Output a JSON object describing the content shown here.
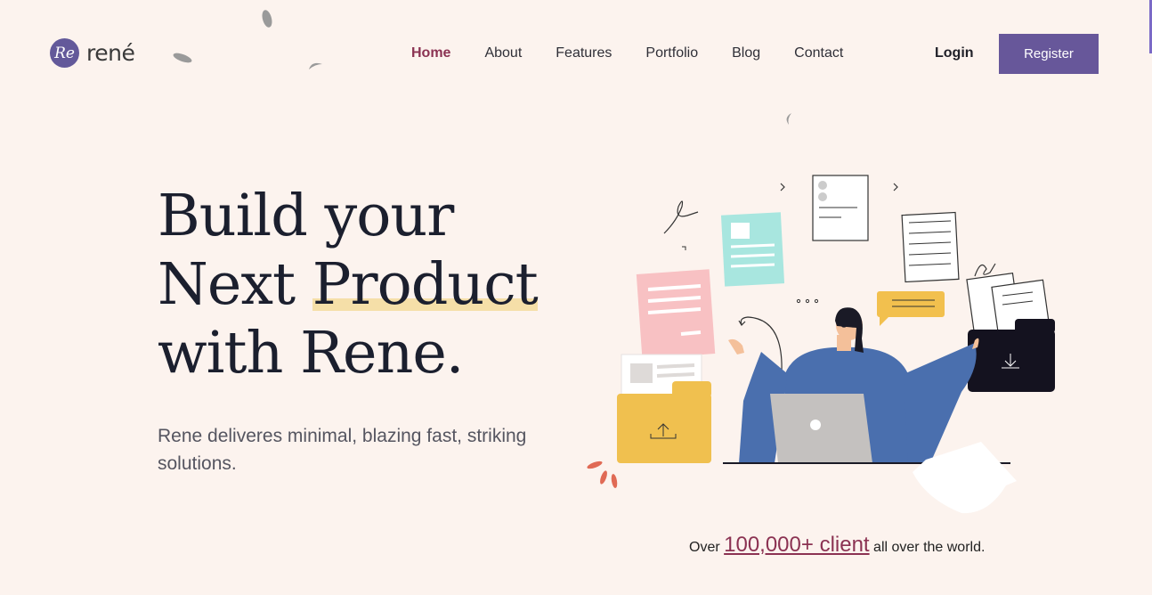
{
  "brand": {
    "logo_mark": "Re",
    "name": "rené"
  },
  "nav": {
    "items": [
      {
        "label": "Home",
        "active": true
      },
      {
        "label": "About",
        "active": false
      },
      {
        "label": "Features",
        "active": false
      },
      {
        "label": "Portfolio",
        "active": false
      },
      {
        "label": "Blog",
        "active": false
      },
      {
        "label": "Contact",
        "active": false
      }
    ],
    "login_label": "Login",
    "register_label": "Register"
  },
  "hero": {
    "headline_line1": "Build your",
    "headline_line2_prefix": "Next ",
    "headline_line2_highlight": "Product",
    "headline_line3": "with Rene.",
    "subtitle": "Rene deliveres minimal, blazing fast, striking solutions."
  },
  "clients": {
    "prefix": "Over ",
    "highlight": "100,000+ client",
    "suffix": " all over the world."
  },
  "colors": {
    "background": "#fcf3ee",
    "accent": "#67579a",
    "active_nav": "#8b3252",
    "highlight": "#f5dfa8"
  },
  "illustration": {
    "icon": "person-at-laptop-illustration"
  }
}
